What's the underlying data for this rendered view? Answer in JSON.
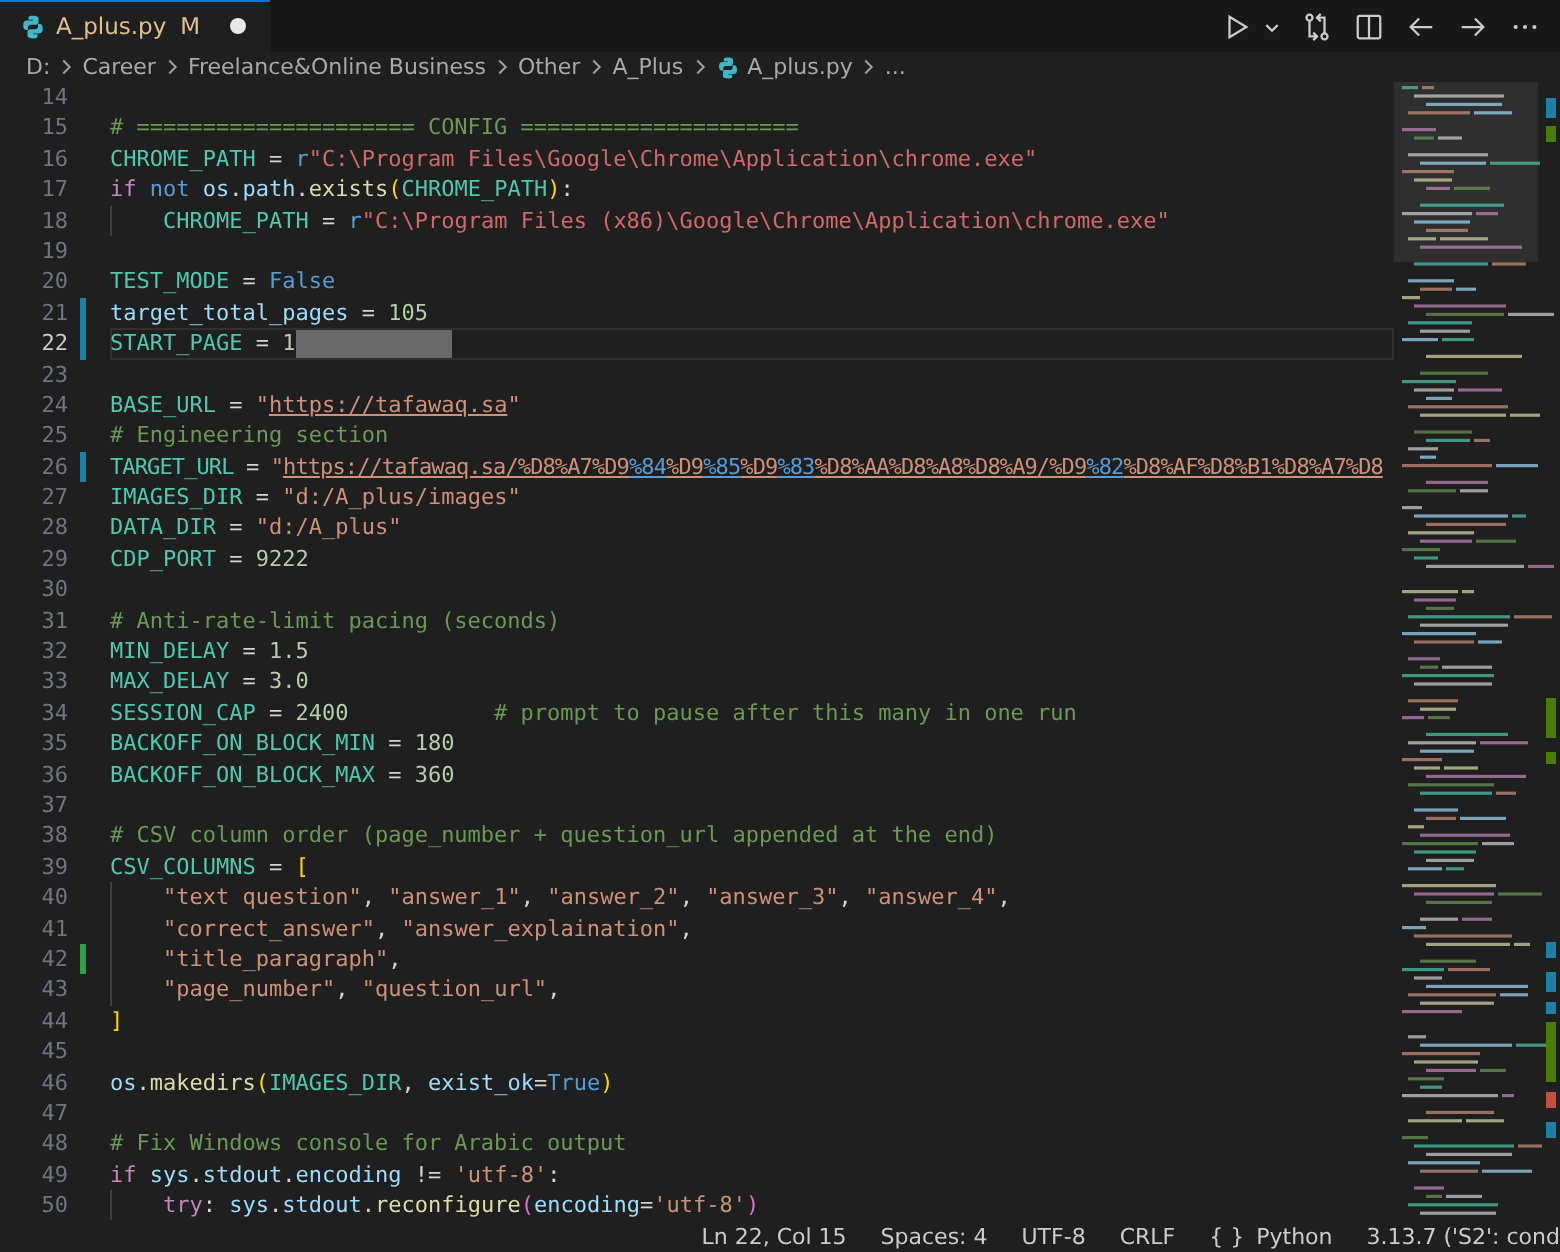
{
  "tabs": [
    {
      "label": "A_plus.py",
      "badge": "M",
      "modified": true,
      "selected": true
    }
  ],
  "breadcrumbs": [
    {
      "label": "D:",
      "kind": "folder"
    },
    {
      "label": "Career",
      "kind": "folder"
    },
    {
      "label": "Freelance&Online Business",
      "kind": "folder"
    },
    {
      "label": "Other",
      "kind": "folder"
    },
    {
      "label": "A_Plus",
      "kind": "folder"
    },
    {
      "label": "A_plus.py",
      "kind": "file"
    },
    {
      "label": "...",
      "kind": "more"
    }
  ],
  "editor": {
    "lines": [
      {
        "number": "14"
      },
      {
        "number": "15",
        "segments": [
          {
            "text": "# ===================== CONFIG =====================",
            "kind": "cmt"
          }
        ]
      },
      {
        "number": "16",
        "segments": [
          {
            "text": "CHROME_PATH",
            "kind": "const"
          },
          {
            "text": " = ",
            "kind": "op"
          },
          {
            "text": "r",
            "kind": "kwb"
          },
          {
            "text": "\"C:\\Program Files\\Google\\Chrome\\Application\\chrome.exe\"",
            "kind": "raw"
          }
        ]
      },
      {
        "number": "17",
        "segments": [
          {
            "text": "if",
            "kind": "kw"
          },
          {
            "text": " not",
            "kind": "kwb"
          },
          {
            "text": " os",
            "kind": "var"
          },
          {
            "text": ".",
            "kind": "plain"
          },
          {
            "text": "path",
            "kind": "var"
          },
          {
            "text": ".",
            "kind": "plain"
          },
          {
            "text": "exists",
            "kind": "fn"
          },
          {
            "text": "(",
            "kind": "brk"
          },
          {
            "text": "CHROME_PATH",
            "kind": "const"
          },
          {
            "text": ")",
            "kind": "brk"
          },
          {
            "text": ":",
            "kind": "plain"
          }
        ]
      },
      {
        "number": "18",
        "indented": true,
        "segments": [
          {
            "text": "CHROME_PATH",
            "kind": "const"
          },
          {
            "text": " = ",
            "kind": "op"
          },
          {
            "text": "r",
            "kind": "kwb"
          },
          {
            "text": "\"C:\\Program Files (x86)\\Google\\Chrome\\Application\\chrome.exe\"",
            "kind": "raw"
          }
        ]
      },
      {
        "number": "19"
      },
      {
        "number": "20",
        "segments": [
          {
            "text": "TEST_MODE",
            "kind": "const"
          },
          {
            "text": " = ",
            "kind": "op"
          },
          {
            "text": "False",
            "kind": "kwb"
          }
        ]
      },
      {
        "number": "21",
        "modified": true,
        "segments": [
          {
            "text": "target_total_pages",
            "kind": "var"
          },
          {
            "text": " = ",
            "kind": "op"
          },
          {
            "text": "105",
            "kind": "num"
          }
        ]
      },
      {
        "number": "22",
        "modified": true,
        "current": true,
        "marked": true,
        "segments": [
          {
            "text": "START_PAGE",
            "kind": "const"
          },
          {
            "text": " = ",
            "kind": "op"
          },
          {
            "text": "1",
            "kind": "num"
          }
        ]
      },
      {
        "number": "23"
      },
      {
        "number": "24",
        "segments": [
          {
            "text": "BASE_URL",
            "kind": "const"
          },
          {
            "text": " = ",
            "kind": "op"
          },
          {
            "text": "\"",
            "kind": "str"
          },
          {
            "text": "https://tafawaq.sa",
            "kind": "link"
          },
          {
            "text": "\"",
            "kind": "str"
          }
        ]
      },
      {
        "number": "25",
        "segments": [
          {
            "text": "# Engineering section",
            "kind": "cmt"
          }
        ]
      },
      {
        "number": "26",
        "modified": true,
        "segments": [
          {
            "text": "TARGET_URL",
            "kind": "const"
          },
          {
            "text": " = ",
            "kind": "op"
          },
          {
            "text": "\"",
            "kind": "str"
          },
          {
            "text": "https://tafawaq.sa/%D8%A7%D9",
            "kind": "link"
          },
          {
            "text": "%84",
            "kind": "fmt"
          },
          {
            "text": "%D9",
            "kind": "link"
          },
          {
            "text": "%85",
            "kind": "fmt"
          },
          {
            "text": "%D9",
            "kind": "link"
          },
          {
            "text": "%83",
            "kind": "fmt"
          },
          {
            "text": "%D8%AA%D8%A8%D8%A9/%D9",
            "kind": "link"
          },
          {
            "text": "%82",
            "kind": "fmt"
          },
          {
            "text": "%D8%AF%D8%B1%D8%A7%D8",
            "kind": "link"
          }
        ]
      },
      {
        "number": "27",
        "segments": [
          {
            "text": "IMAGES_DIR",
            "kind": "const"
          },
          {
            "text": " = ",
            "kind": "op"
          },
          {
            "text": "\"d:/A_plus/images\"",
            "kind": "str"
          }
        ]
      },
      {
        "number": "28",
        "segments": [
          {
            "text": "DATA_DIR",
            "kind": "const"
          },
          {
            "text": " = ",
            "kind": "op"
          },
          {
            "text": "\"d:/A_plus\"",
            "kind": "str"
          }
        ]
      },
      {
        "number": "29",
        "segments": [
          {
            "text": "CDP_PORT",
            "kind": "const"
          },
          {
            "text": " = ",
            "kind": "op"
          },
          {
            "text": "9222",
            "kind": "num"
          }
        ]
      },
      {
        "number": "30"
      },
      {
        "number": "31",
        "segments": [
          {
            "text": "# Anti-rate-limit pacing (seconds)",
            "kind": "cmt"
          }
        ]
      },
      {
        "number": "32",
        "segments": [
          {
            "text": "MIN_DELAY",
            "kind": "const"
          },
          {
            "text": " = ",
            "kind": "op"
          },
          {
            "text": "1.5",
            "kind": "num"
          }
        ]
      },
      {
        "number": "33",
        "segments": [
          {
            "text": "MAX_DELAY",
            "kind": "const"
          },
          {
            "text": " = ",
            "kind": "op"
          },
          {
            "text": "3.0",
            "kind": "num"
          }
        ]
      },
      {
        "number": "34",
        "segments": [
          {
            "text": "SESSION_CAP",
            "kind": "const"
          },
          {
            "text": " = ",
            "kind": "op"
          },
          {
            "text": "2400",
            "kind": "num"
          },
          {
            "text": "# prompt to pause after this many in one run",
            "kind": "tcmt"
          }
        ]
      },
      {
        "number": "35",
        "segments": [
          {
            "text": "BACKOFF_ON_BLOCK_MIN",
            "kind": "const"
          },
          {
            "text": " = ",
            "kind": "op"
          },
          {
            "text": "180",
            "kind": "num"
          }
        ]
      },
      {
        "number": "36",
        "segments": [
          {
            "text": "BACKOFF_ON_BLOCK_MAX",
            "kind": "const"
          },
          {
            "text": " = ",
            "kind": "op"
          },
          {
            "text": "360",
            "kind": "num"
          }
        ]
      },
      {
        "number": "37"
      },
      {
        "number": "38",
        "segments": [
          {
            "text": "# CSV column order (page_number + question_url appended at the end)",
            "kind": "cmt"
          }
        ]
      },
      {
        "number": "39",
        "segments": [
          {
            "text": "CSV_COLUMNS",
            "kind": "const"
          },
          {
            "text": " = ",
            "kind": "op"
          },
          {
            "text": "[",
            "kind": "brk"
          }
        ]
      },
      {
        "number": "40",
        "indented": true,
        "segments": [
          {
            "text": "\"text question\"",
            "kind": "str"
          },
          {
            "text": ", ",
            "kind": "plain"
          },
          {
            "text": "\"answer_1\"",
            "kind": "str"
          },
          {
            "text": ", ",
            "kind": "plain"
          },
          {
            "text": "\"answer_2\"",
            "kind": "str"
          },
          {
            "text": ", ",
            "kind": "plain"
          },
          {
            "text": "\"answer_3\"",
            "kind": "str"
          },
          {
            "text": ", ",
            "kind": "plain"
          },
          {
            "text": "\"answer_4\"",
            "kind": "str"
          },
          {
            "text": ",",
            "kind": "plain"
          }
        ]
      },
      {
        "number": "41",
        "indented": true,
        "segments": [
          {
            "text": "\"correct_answer\"",
            "kind": "str"
          },
          {
            "text": ", ",
            "kind": "plain"
          },
          {
            "text": "\"answer_explaination\"",
            "kind": "str"
          },
          {
            "text": ",",
            "kind": "plain"
          }
        ]
      },
      {
        "number": "42",
        "added": true,
        "indented": true,
        "segments": [
          {
            "text": "\"title_paragraph\"",
            "kind": "str"
          },
          {
            "text": ",",
            "kind": "plain"
          }
        ]
      },
      {
        "number": "43",
        "indented": true,
        "segments": [
          {
            "text": "\"page_number\"",
            "kind": "str"
          },
          {
            "text": ", ",
            "kind": "plain"
          },
          {
            "text": "\"question_url\"",
            "kind": "str"
          },
          {
            "text": ",",
            "kind": "plain"
          }
        ]
      },
      {
        "number": "44",
        "segments": [
          {
            "text": "]",
            "kind": "brk"
          }
        ]
      },
      {
        "number": "45"
      },
      {
        "number": "46",
        "segments": [
          {
            "text": "os",
            "kind": "var"
          },
          {
            "text": ".",
            "kind": "plain"
          },
          {
            "text": "makedirs",
            "kind": "fn"
          },
          {
            "text": "(",
            "kind": "brk"
          },
          {
            "text": "IMAGES_DIR",
            "kind": "const"
          },
          {
            "text": ", ",
            "kind": "plain"
          },
          {
            "text": "exist_ok",
            "kind": "param"
          },
          {
            "text": "=",
            "kind": "op"
          },
          {
            "text": "True",
            "kind": "kwb"
          },
          {
            "text": ")",
            "kind": "brk"
          }
        ]
      },
      {
        "number": "47"
      },
      {
        "number": "48",
        "segments": [
          {
            "text": "# Fix Windows console for Arabic output",
            "kind": "cmt"
          }
        ]
      },
      {
        "number": "49",
        "segments": [
          {
            "text": "if",
            "kind": "kw"
          },
          {
            "text": " sys",
            "kind": "var"
          },
          {
            "text": ".",
            "kind": "plain"
          },
          {
            "text": "stdout",
            "kind": "var"
          },
          {
            "text": ".",
            "kind": "plain"
          },
          {
            "text": "encoding",
            "kind": "var"
          },
          {
            "text": " != ",
            "kind": "op"
          },
          {
            "text": "'utf-8'",
            "kind": "str"
          },
          {
            "text": ":",
            "kind": "plain"
          }
        ]
      },
      {
        "number": "50",
        "indented": true,
        "segments": [
          {
            "text": "try",
            "kind": "kw"
          },
          {
            "text": ": ",
            "kind": "plain"
          },
          {
            "text": "sys",
            "kind": "var"
          },
          {
            "text": ".",
            "kind": "plain"
          },
          {
            "text": "stdout",
            "kind": "var"
          },
          {
            "text": ".",
            "kind": "plain"
          },
          {
            "text": "reconfigure",
            "kind": "fn"
          },
          {
            "text": "(",
            "kind": "brk2"
          },
          {
            "text": "encoding",
            "kind": "param"
          },
          {
            "text": "=",
            "kind": "op"
          },
          {
            "text": "'utf-8'",
            "kind": "str"
          },
          {
            "text": ")",
            "kind": "brk2"
          }
        ]
      }
    ]
  },
  "status_bar": [
    {
      "text": "Ln 22, Col 15"
    },
    {
      "text": "Spaces: 4"
    },
    {
      "text": "UTF-8"
    },
    {
      "text": "CRLF"
    },
    {
      "icon": "{ }",
      "text": "Python"
    },
    {
      "text": "3.13.7 ('S2': cond"
    }
  ]
}
